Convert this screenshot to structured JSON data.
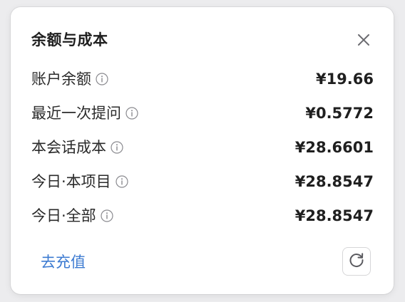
{
  "dialog": {
    "title": "余额与成本",
    "close_icon": "close-icon"
  },
  "rows": [
    {
      "label": "账户余额",
      "value": "¥19.66",
      "icon": "info-icon"
    },
    {
      "label": "最近一次提问",
      "value": "¥0.5772",
      "icon": "info-icon"
    },
    {
      "label": "本会话成本",
      "value": "¥28.6601",
      "icon": "info-icon"
    },
    {
      "label": "今日·本项目",
      "value": "¥28.8547",
      "icon": "info-icon"
    },
    {
      "label": "今日·全部",
      "value": "¥28.8547",
      "icon": "info-icon"
    }
  ],
  "footer": {
    "recharge_label": "去充值",
    "refresh_icon": "refresh-icon"
  },
  "colors": {
    "link": "#3d7bd1",
    "text": "#1f1f1f",
    "muted_icon": "#8a8a8f"
  }
}
